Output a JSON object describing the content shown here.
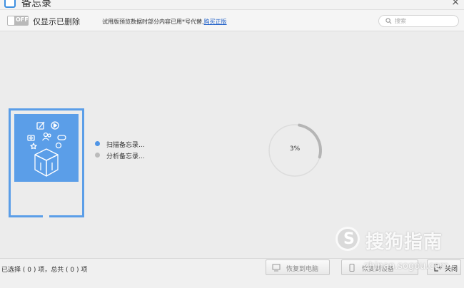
{
  "window": {
    "title": "备忘录",
    "close_glyph": "×"
  },
  "toolbar": {
    "toggle_state": "OFF",
    "toggle_label": "仅显示已删除",
    "trial_notice": "试用版预览数据时部分内容已用*号代替,",
    "purchase_link": "购买正版",
    "search_placeholder": "搜索"
  },
  "scan": {
    "steps": [
      {
        "label": "扫描备忘录...",
        "state": "active"
      },
      {
        "label": "分析备忘录...",
        "state": "pending"
      }
    ],
    "progress_text": "3%",
    "progress_value": 0.03
  },
  "footer": {
    "selection_status": "已选择 ( 0 ) 项，总共 ( 0 ) 项",
    "restore_to_pc": "恢复到电脑",
    "restore_to_phone": "恢复到设备",
    "close": "关闭"
  },
  "watermark": {
    "brand": "搜狗指南",
    "url": "zhinan.sogou.com"
  },
  "colors": {
    "accent": "#4f95e6",
    "illustration": "#5b9ee8",
    "link": "#2060c8"
  },
  "icons": {
    "app": "memo-app-icon",
    "search": "search-icon",
    "restore_pc": "monitor-icon",
    "restore_phone": "phone-icon",
    "close": "exit-icon"
  }
}
